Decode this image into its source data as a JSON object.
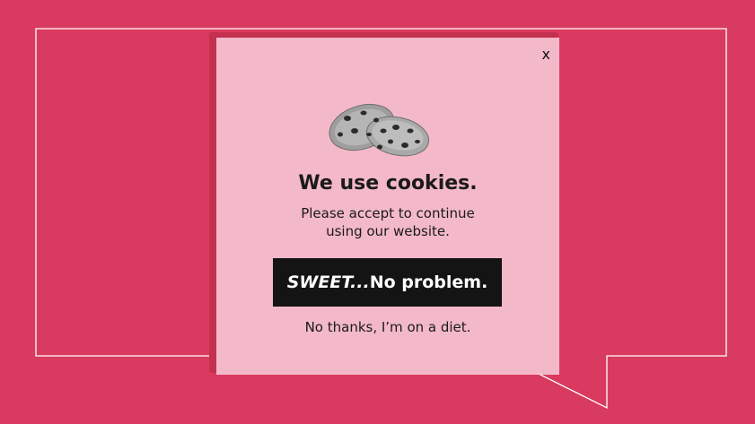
{
  "dialog": {
    "close_label": "x",
    "title": "We use cookies.",
    "message_line1": "Please accept to continue",
    "message_line2": "using our website.",
    "accept_emphasis": "SWEET...",
    "accept_rest": "No problem.",
    "decline_label": "No thanks, I’m on a diet.",
    "illustration": "cookies-illustration"
  },
  "colors": {
    "background": "#d93a5f",
    "dialog_background": "#f7c4d2",
    "button_background": "#141414",
    "button_text": "#ffffff",
    "outline": "#ffffff"
  }
}
